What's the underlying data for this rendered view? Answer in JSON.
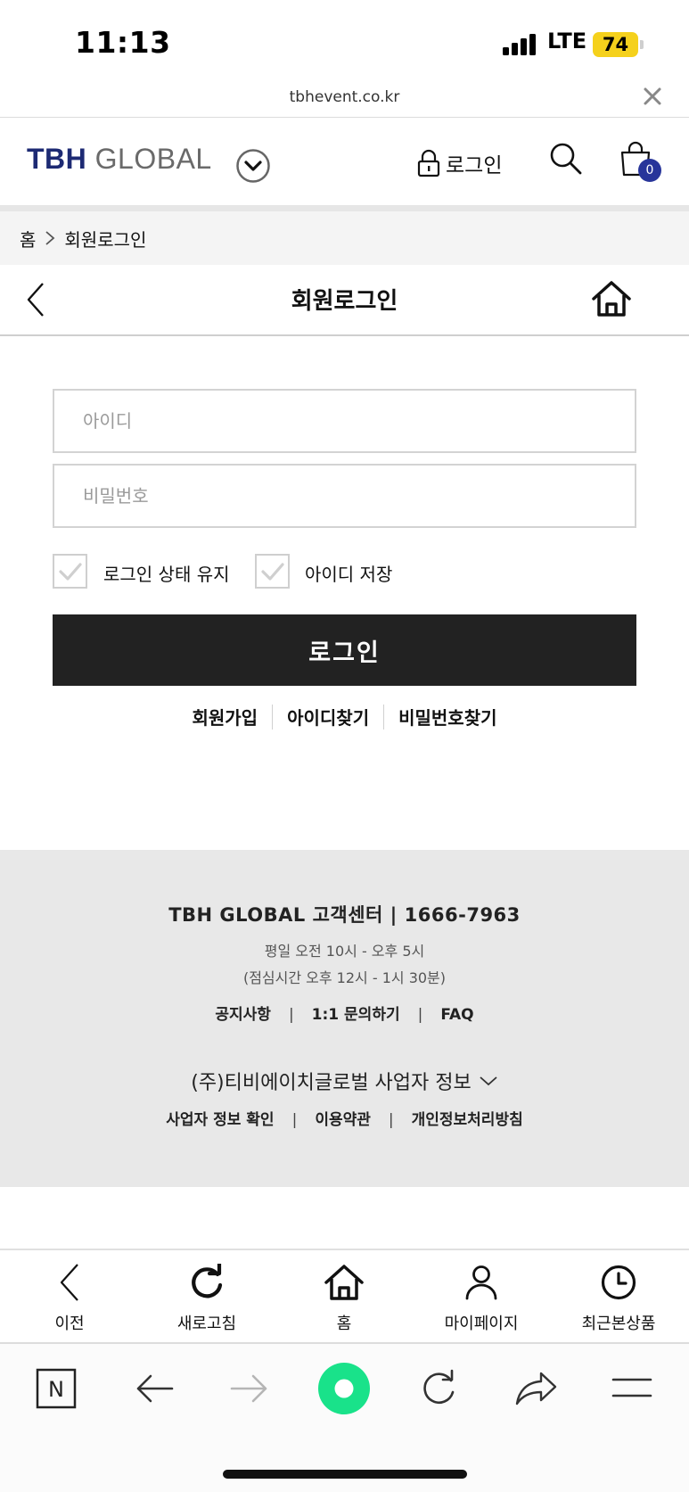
{
  "status": {
    "time": "11:13",
    "network": "LTE",
    "battery": "74"
  },
  "urlbar": {
    "domain": "tbhevent.co.kr"
  },
  "header": {
    "logo_brand": "TBH",
    "logo_rest": "GLOBAL",
    "login_label": "로그인",
    "cart_count": "0"
  },
  "breadcrumb": {
    "home": "홈",
    "current": "회원로그인"
  },
  "page": {
    "title": "회원로그인"
  },
  "form": {
    "id_placeholder": "아이디",
    "pw_placeholder": "비밀번호",
    "keep_login_label": "로그인 상태 유지",
    "save_id_label": "아이디 저장",
    "login_button": "로그인",
    "links": [
      "회원가입",
      "아이디찾기",
      "비밀번호찾기"
    ]
  },
  "footer": {
    "cs_line": "TBH GLOBAL 고객센터 | 1666-7963",
    "hours": "평일 오전 10시 - 오후 5시",
    "lunch": "(점심시간 오후 12시 - 1시 30분)",
    "links1": [
      "공지사항",
      "1:1 문의하기",
      "FAQ"
    ],
    "biz_info": "(주)티비에이치글로벌 사업자 정보",
    "links2": [
      "사업자 정보 확인",
      "이용약관",
      "개인정보처리방침"
    ]
  },
  "site_nav": [
    {
      "label": "이전",
      "icon": "chevron-left-icon"
    },
    {
      "label": "새로고침",
      "icon": "refresh-icon"
    },
    {
      "label": "홈",
      "icon": "home-icon"
    },
    {
      "label": "마이페이지",
      "icon": "user-icon"
    },
    {
      "label": "최근본상품",
      "icon": "clock-icon"
    }
  ],
  "browser_bar": {
    "n_label": "N"
  },
  "colors": {
    "brand_navy": "#1d2a73",
    "badge_blue": "#28359a",
    "battery_yellow": "#f5d11c",
    "naver_green": "#19e28a",
    "button_dark": "#222222"
  }
}
